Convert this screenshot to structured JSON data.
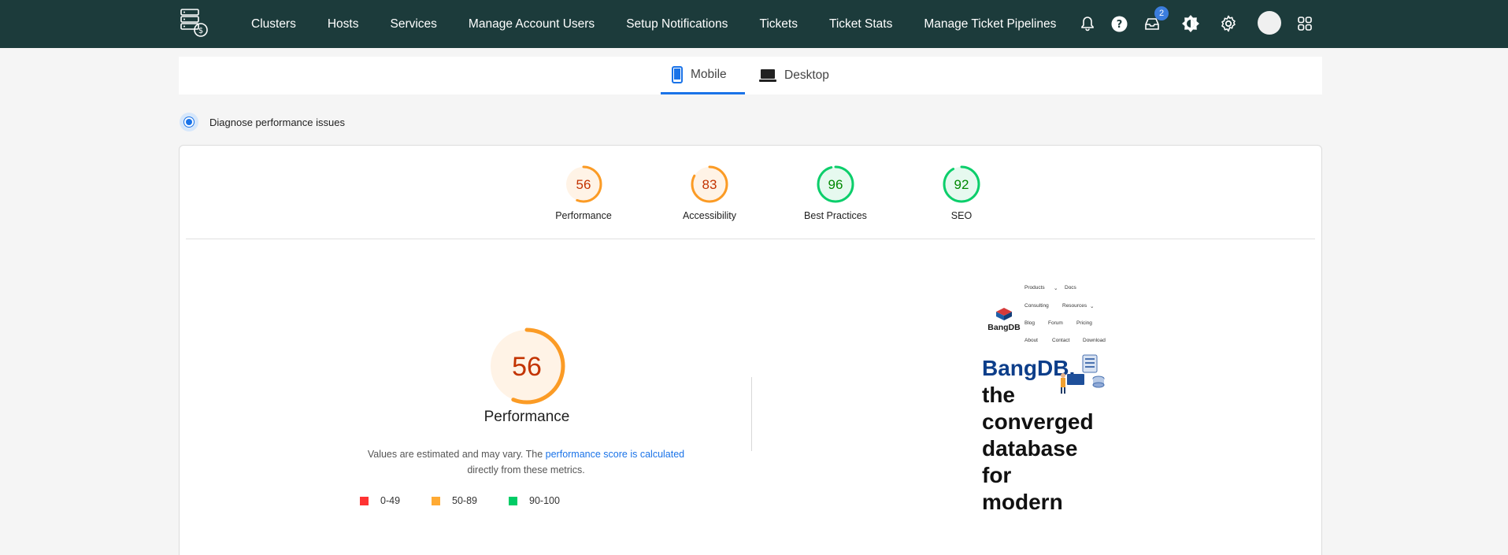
{
  "nav": {
    "links": [
      "Clusters",
      "Hosts",
      "Services",
      "Manage Account Users",
      "Setup Notifications",
      "Tickets",
      "Ticket Stats",
      "Manage Ticket Pipelines"
    ],
    "inbox_badge": "2",
    "icons": [
      "bell-icon",
      "help-icon",
      "inbox-icon",
      "theme-toggle-icon",
      "gear-icon",
      "avatar",
      "apps-grid-icon"
    ]
  },
  "tabs": [
    {
      "label": "Mobile",
      "icon": "mobile-icon",
      "active": true
    },
    {
      "label": "Desktop",
      "icon": "laptop-icon",
      "active": false
    }
  ],
  "diagnose": {
    "label": "Diagnose performance issues"
  },
  "scores": [
    {
      "label": "Performance",
      "value": 56,
      "color": "#fb9b25"
    },
    {
      "label": "Accessibility",
      "value": 83,
      "color": "#fb9b25"
    },
    {
      "label": "Best Practices",
      "value": 96,
      "color": "#0cce6b"
    },
    {
      "label": "SEO",
      "value": 92,
      "color": "#0cce6b"
    }
  ],
  "main_score": {
    "label": "Performance",
    "value": 56
  },
  "description": {
    "prefix": "Values are estimated and may vary. The ",
    "link": "performance score is calculated",
    "suffix": "directly from these metrics."
  },
  "legend": [
    {
      "label": "0-49",
      "color": "#ff3333"
    },
    {
      "label": "50-89",
      "color": "#ffaa33"
    },
    {
      "label": "90-100",
      "color": "#00cc66"
    }
  ],
  "screenshot": {
    "logo_text": "BangDB",
    "menu": [
      "Products",
      "Docs",
      "Consulting",
      "Resources",
      "Blog",
      "Forum",
      "Pricing",
      "About",
      "Contact",
      "Download"
    ],
    "hero_brand": "BangDB,",
    "hero_lines": [
      "the",
      "converged",
      "database",
      "for",
      "modern"
    ]
  }
}
